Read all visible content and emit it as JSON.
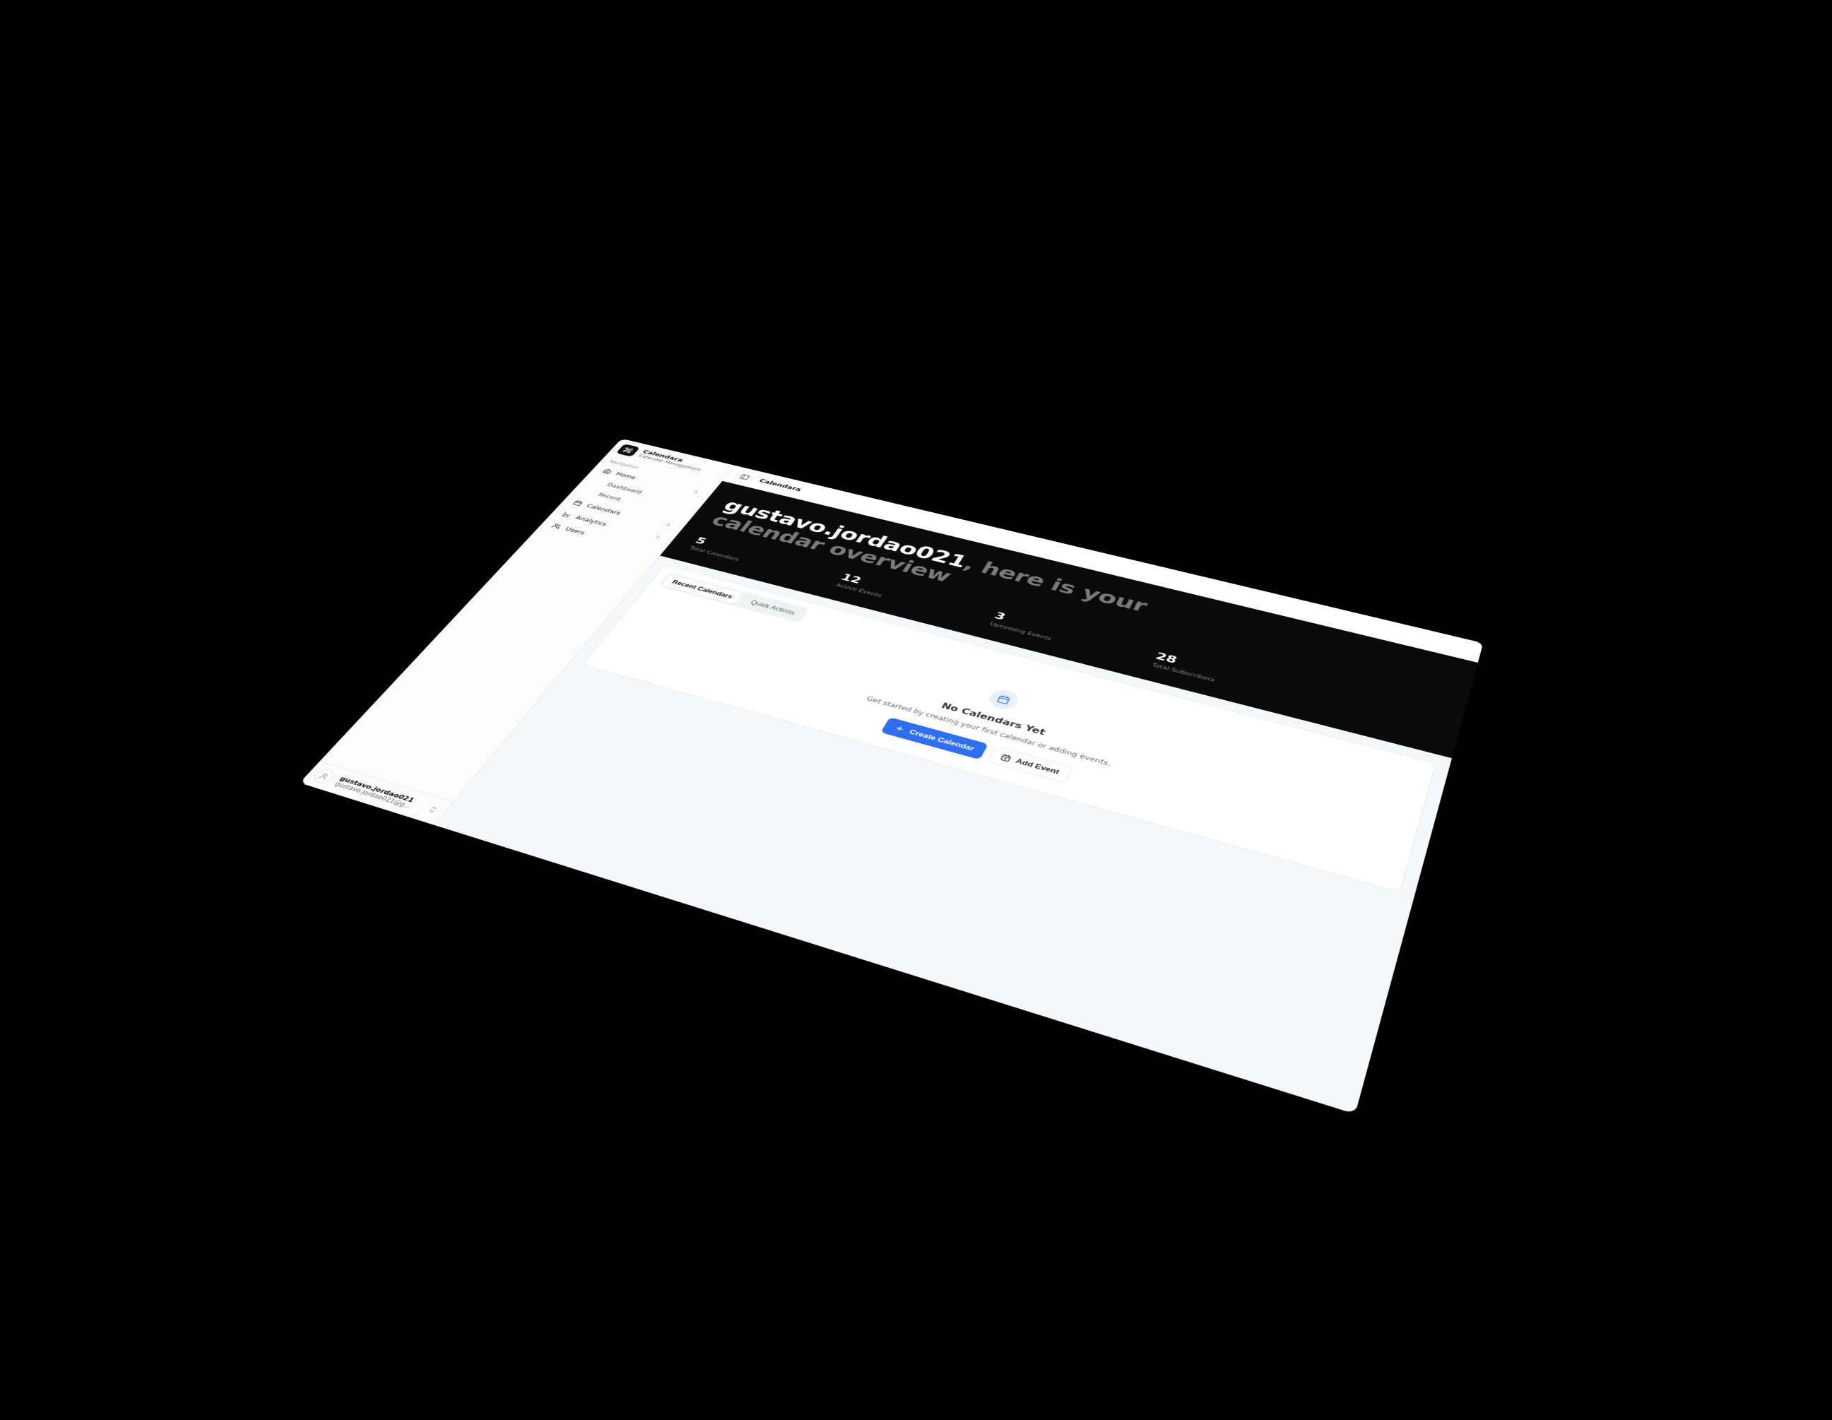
{
  "app": {
    "name": "Calendara",
    "subtitle": "Calendar Management",
    "topbar_title": "Calendara"
  },
  "colors": {
    "accent": "#2e6ff2",
    "surface": "#ffffff",
    "dark": "#0a0a0a"
  },
  "icons": {
    "command": "command-icon",
    "panel_left": "panel-left-icon",
    "home": "home-icon",
    "chevron_right": "chevron-right-icon",
    "updown": "chevrons-up-down-icon",
    "calendar": "calendar-icon",
    "chart": "chart-icon",
    "users": "users-icon",
    "user": "user-icon",
    "plus": "plus-icon",
    "calendar_plus": "calendar-plus-icon"
  },
  "sidebar": {
    "section_title": "Navigation",
    "items": [
      {
        "id": "home",
        "label": "Home",
        "icon": "home-icon",
        "expandable": true,
        "children": [
          {
            "id": "dashboard",
            "label": "Dashboard"
          },
          {
            "id": "recent",
            "label": "Recent"
          }
        ]
      },
      {
        "id": "calendars",
        "label": "Calendars",
        "icon": "calendar-icon",
        "expandable": true
      },
      {
        "id": "analytics",
        "label": "Analytics",
        "icon": "chart-icon",
        "expandable": true
      },
      {
        "id": "users",
        "label": "Users",
        "icon": "users-icon",
        "expandable": false
      }
    ],
    "footer": {
      "username": "gustavo.jordao021",
      "email_truncated": "gustavo.jordao021@gma..."
    }
  },
  "hero": {
    "user_name": "gustavo.jordao021",
    "line1_suffix": ", here is your",
    "line2": "calendar overview",
    "stats": [
      {
        "value": "5",
        "label": "Total Calendars"
      },
      {
        "value": "12",
        "label": "Active Events"
      },
      {
        "value": "3",
        "label": "Upcoming Events"
      },
      {
        "value": "28",
        "label": "Total Subscribers"
      }
    ]
  },
  "panel": {
    "tabs": [
      {
        "id": "recent",
        "label": "Recent Calendars",
        "active": true
      },
      {
        "id": "quick",
        "label": "Quick Actions",
        "active": false
      }
    ],
    "empty": {
      "title": "No Calendars Yet",
      "subtitle": "Get started by creating your first calendar or adding events.",
      "primary_cta": "Create Calendar",
      "secondary_cta": "Add Event"
    }
  }
}
